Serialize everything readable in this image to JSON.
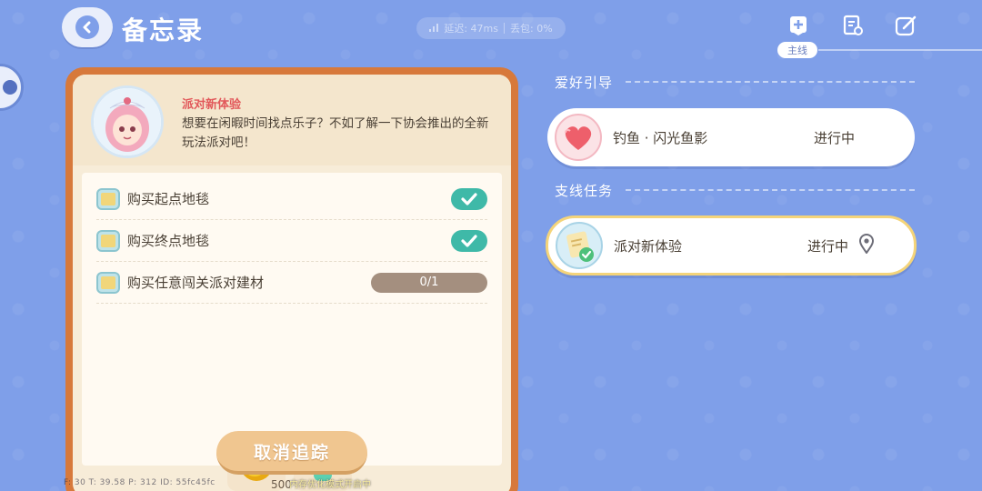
{
  "header": {
    "title": "备忘录",
    "network_latency": "延迟: 47ms",
    "network_loss": "丢包: 0%",
    "main_tag": "主线"
  },
  "quest": {
    "name": "派对新体验",
    "description": "想要在闲暇时间找点乐子？不如了解一下协会推出的全新玩法派对吧！",
    "tasks": [
      {
        "label": "购买起点地毯",
        "status": "done"
      },
      {
        "label": "购买终点地毯",
        "status": "done"
      },
      {
        "label": "购买任意闯关派对建材",
        "progress": "0/1"
      }
    ],
    "rewards": [
      {
        "icon": "gold-coin-icon",
        "count": "500"
      },
      {
        "icon": "macaron-icon",
        "count": ""
      }
    ],
    "cancel_label": "取消追踪"
  },
  "right": {
    "hobby_section": "爱好引导",
    "hobby_quest": {
      "title": "钓鱼 · 闪光鱼影",
      "status": "进行中"
    },
    "side_section": "支线任务",
    "side_quest": {
      "title": "派对新体验",
      "status": "进行中"
    }
  },
  "footer": {
    "debug": "F: 30   T: 39.58   P: 312   ID: 55fc45fc",
    "tip": "内存优化模式开启中"
  },
  "colors": {
    "background": "#7f9fe9",
    "panel_border": "#d7793b",
    "check_green": "#3fb9a8",
    "quest_name_red": "#e2585a"
  }
}
